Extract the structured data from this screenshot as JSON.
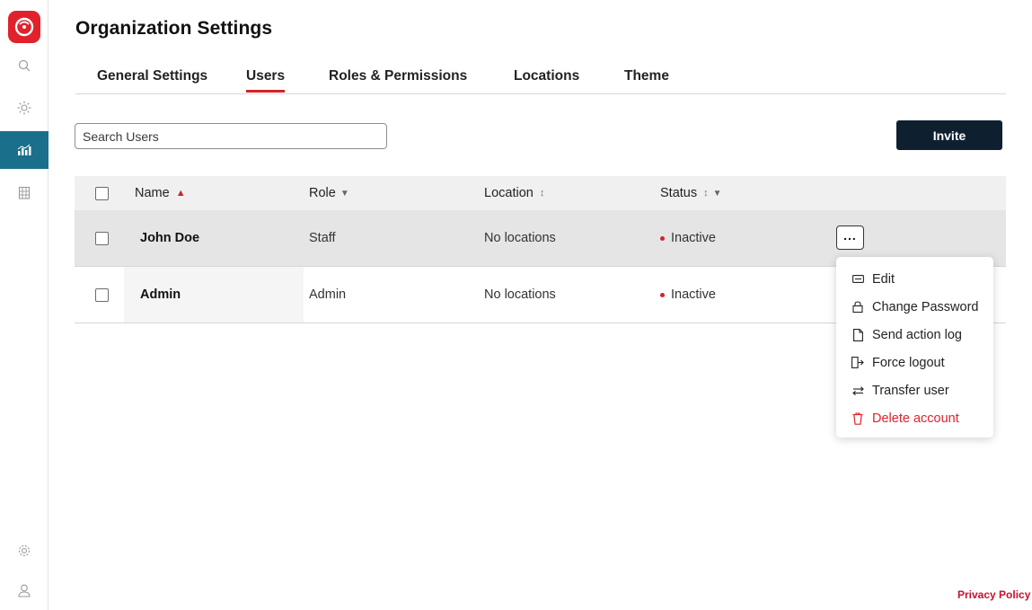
{
  "colors": {
    "brand_red": "#e0222d",
    "active_nav": "#1a6f8a",
    "invite_bg": "#0e2030",
    "status_dot": "#d2232a"
  },
  "sidebar": {
    "logo_icon": "app-logo",
    "items": [
      {
        "icon": "search-icon",
        "active": false
      },
      {
        "icon": "sun-icon",
        "active": false
      },
      {
        "icon": "analytics-icon",
        "active": true
      },
      {
        "icon": "building-icon",
        "active": false
      }
    ],
    "bottom": [
      {
        "icon": "gear-icon"
      },
      {
        "icon": "user-icon"
      }
    ]
  },
  "header": {
    "title": "Organization Settings"
  },
  "tabs": [
    {
      "label": "General Settings",
      "active": false
    },
    {
      "label": "Users",
      "active": true
    },
    {
      "label": "Roles & Permissions",
      "active": false
    },
    {
      "label": "Locations",
      "active": false
    },
    {
      "label": "Theme",
      "active": false
    }
  ],
  "search": {
    "placeholder": "Search Users",
    "value": ""
  },
  "invite_label": "Invite",
  "table": {
    "columns": {
      "name": "Name",
      "role": "Role",
      "location": "Location",
      "status": "Status"
    },
    "rows": [
      {
        "name": "John Doe",
        "role": "Staff",
        "location": "No locations",
        "status": "Inactive"
      },
      {
        "name": "Admin",
        "role": "Admin",
        "location": "No locations",
        "status": "Inactive"
      }
    ],
    "more_label": "..."
  },
  "menu": {
    "items": [
      {
        "label": "Edit",
        "icon": "edit-icon"
      },
      {
        "label": "Change Password",
        "icon": "lock-icon"
      },
      {
        "label": "Send action log",
        "icon": "document-icon"
      },
      {
        "label": "Force logout",
        "icon": "logout-icon"
      },
      {
        "label": "Transfer user",
        "icon": "transfer-icon"
      },
      {
        "label": "Delete account",
        "icon": "trash-icon"
      }
    ]
  },
  "footer": {
    "privacy": "Privacy Policy"
  }
}
